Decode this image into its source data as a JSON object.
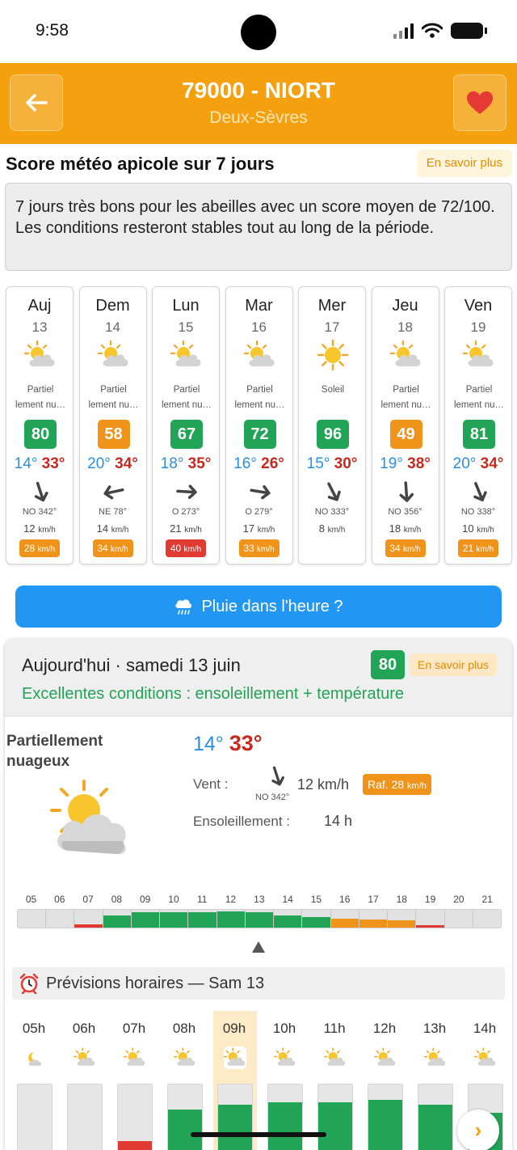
{
  "status": {
    "time": "9:58"
  },
  "header": {
    "title": "79000 - NIORT",
    "subtitle": "Deux-Sèvres",
    "back_icon": "arrow-left-icon",
    "favorite_icon": "heart-icon"
  },
  "score_section": {
    "title": "Score météo apicole sur 7 jours",
    "learn_more": "En savoir plus",
    "summary": "7 jours très bons pour les abeilles avec un score moyen de 72/100. Les conditions resteront stables tout au long de la période."
  },
  "colors": {
    "good": "#22a457",
    "medium": "#f0931a",
    "bad": "#e03a32",
    "accent": "#f5a00f",
    "rain": "#2196f3"
  },
  "days": [
    {
      "name": "Auj",
      "num": "13",
      "icon": "partly",
      "cond": [
        "Partiel",
        "lement nu…"
      ],
      "score": "80",
      "score_level": "good",
      "tmin": "14°",
      "tmax": "33°",
      "wind_deg": 342,
      "wind_dir": "NO 342°",
      "speed": "12",
      "gust": "28",
      "gust_level": "medium"
    },
    {
      "name": "Dem",
      "num": "14",
      "icon": "partly",
      "cond": [
        "Partiel",
        "lement nu…"
      ],
      "score": "58",
      "score_level": "medium",
      "tmin": "20°",
      "tmax": "34°",
      "wind_deg": 78,
      "wind_dir": "NE 78°",
      "speed": "14",
      "gust": "34",
      "gust_level": "medium"
    },
    {
      "name": "Lun",
      "num": "15",
      "icon": "partly",
      "cond": [
        "Partiel",
        "lement nu…"
      ],
      "score": "67",
      "score_level": "good",
      "tmin": "18°",
      "tmax": "35°",
      "wind_deg": 273,
      "wind_dir": "O 273°",
      "speed": "21",
      "gust": "40",
      "gust_level": "bad"
    },
    {
      "name": "Mar",
      "num": "16",
      "icon": "partly",
      "cond": [
        "Partiel",
        "lement nu…"
      ],
      "score": "72",
      "score_level": "good",
      "tmin": "16°",
      "tmax": "26°",
      "wind_deg": 279,
      "wind_dir": "O 279°",
      "speed": "17",
      "gust": "33",
      "gust_level": "medium"
    },
    {
      "name": "Mer",
      "num": "17",
      "icon": "sun",
      "cond": [
        "Soleil",
        ""
      ],
      "score": "96",
      "score_level": "good",
      "tmin": "15°",
      "tmax": "30°",
      "wind_deg": 333,
      "wind_dir": "NO 333°",
      "speed": "8",
      "gust": "",
      "gust_level": ""
    },
    {
      "name": "Jeu",
      "num": "18",
      "icon": "partly",
      "cond": [
        "Partiel",
        "lement nu…"
      ],
      "score": "49",
      "score_level": "medium",
      "tmin": "19°",
      "tmax": "38°",
      "wind_deg": 356,
      "wind_dir": "NO 356°",
      "speed": "18",
      "gust": "34",
      "gust_level": "medium"
    },
    {
      "name": "Ven",
      "num": "19",
      "icon": "partly",
      "cond": [
        "Partiel",
        "lement nu…"
      ],
      "score": "81",
      "score_level": "good",
      "tmin": "20°",
      "tmax": "34°",
      "wind_deg": 338,
      "wind_dir": "NO 338°",
      "speed": "10",
      "gust": "21",
      "gust_level": "medium"
    }
  ],
  "units": {
    "speed": "km/h"
  },
  "rain_button": {
    "label": "Pluie dans l'heure ?",
    "icon": "rain-cloud-icon"
  },
  "today": {
    "date": "Aujourd'hui · samedi 13 juin",
    "score": "80",
    "learn_more": "En savoir plus",
    "condition_summary": "Excellentes conditions : ensoleillement + température",
    "label": "Partiellement nuageux",
    "tmin": "14°",
    "tmax": "33°",
    "wind_label": "Vent :",
    "wind_deg": 342,
    "wind_dir": "NO 342°",
    "wind_speed": "12 km/h",
    "gust_prefix": "Raf. 28",
    "gust_unit": "km/h",
    "sun_label": "Ensoleillement :",
    "sun_value": "14 h"
  },
  "hour_ruler": [
    {
      "h": "05",
      "level": "none",
      "fill": 0
    },
    {
      "h": "06",
      "level": "none",
      "fill": 0
    },
    {
      "h": "07",
      "level": "bad",
      "fill": 0.2
    },
    {
      "h": "08",
      "level": "good",
      "fill": 0.7
    },
    {
      "h": "09",
      "level": "good",
      "fill": 0.85
    },
    {
      "h": "10",
      "level": "good",
      "fill": 0.85
    },
    {
      "h": "11",
      "level": "good",
      "fill": 0.85
    },
    {
      "h": "12",
      "level": "good",
      "fill": 0.9
    },
    {
      "h": "13",
      "level": "good",
      "fill": 0.85
    },
    {
      "h": "14",
      "level": "good",
      "fill": 0.7
    },
    {
      "h": "15",
      "level": "good",
      "fill": 0.6
    },
    {
      "h": "16",
      "level": "medium",
      "fill": 0.5
    },
    {
      "h": "17",
      "level": "medium",
      "fill": 0.45
    },
    {
      "h": "18",
      "level": "medium",
      "fill": 0.4
    },
    {
      "h": "19",
      "level": "bad",
      "fill": 0.15
    },
    {
      "h": "20",
      "level": "none",
      "fill": 0
    },
    {
      "h": "21",
      "level": "none",
      "fill": 0
    }
  ],
  "hourly": {
    "title": "Prévisions horaires — Sam 13",
    "alarm_icon": "alarm-clock-icon",
    "next_icon": "chevron-right-icon",
    "hours": [
      {
        "label": "05h",
        "icon": "moon",
        "level": "none",
        "fill": 0,
        "selected": false
      },
      {
        "label": "06h",
        "icon": "partly",
        "level": "none",
        "fill": 0,
        "selected": false
      },
      {
        "label": "07h",
        "icon": "partly",
        "level": "bad",
        "fill": 0.2,
        "selected": false
      },
      {
        "label": "08h",
        "icon": "partly",
        "level": "good",
        "fill": 0.65,
        "selected": false
      },
      {
        "label": "09h",
        "icon": "partly",
        "level": "good",
        "fill": 0.72,
        "selected": true
      },
      {
        "label": "10h",
        "icon": "partly",
        "level": "good",
        "fill": 0.75,
        "selected": false
      },
      {
        "label": "11h",
        "icon": "partly",
        "level": "good",
        "fill": 0.75,
        "selected": false
      },
      {
        "label": "12h",
        "icon": "partly",
        "level": "good",
        "fill": 0.78,
        "selected": false
      },
      {
        "label": "13h",
        "icon": "partly",
        "level": "good",
        "fill": 0.72,
        "selected": false
      },
      {
        "label": "14h",
        "icon": "partly",
        "level": "good",
        "fill": 0.6,
        "selected": false
      }
    ]
  }
}
